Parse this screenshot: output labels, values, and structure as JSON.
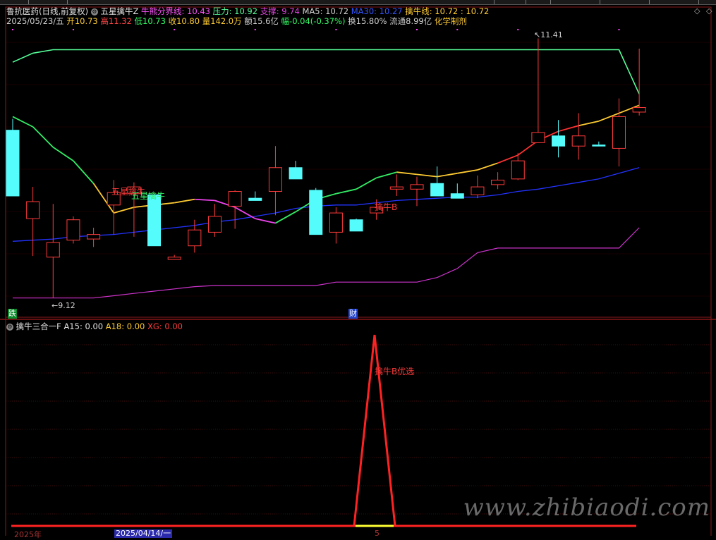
{
  "header": {
    "stock_name": "鲁抗医药(日线,前复权)",
    "indicator_name": "五星擒牛Z",
    "bull_line_label": "牛熊分界线: 10.43",
    "pressure_label": "压力: 10.92",
    "support_label": "支撑: 9.74",
    "ma5_label": "MA5: 10.72",
    "ma30_label": "MA30: 10.27",
    "qinniu_label": "擒牛线: 10.72 : 10.72",
    "date": "2025/05/23/五",
    "open": "开10.73",
    "high": "高11.32",
    "low": "低10.73",
    "close": "收10.80",
    "volume": "量142.0万",
    "amount": "额15.6亿",
    "change": "幅-0.04(-0.37%)",
    "turnover": "换15.80%",
    "float": "流通8.99亿",
    "sector": "化学制剂"
  },
  "sub_header": {
    "indicator_name": "擒牛三合一F",
    "a15": "A15: 0.00",
    "a18": "A18: 0.00",
    "xg": "XG: 0.00"
  },
  "annotations": {
    "high_marker": "11.41",
    "low_marker": "9.12",
    "signal_left_1": "五星擒牛",
    "signal_left_2": "五星擒牛",
    "signal_b": "擒牛B",
    "sub_signal": "擒牛B优选",
    "badge_die": "跌",
    "badge_cai": "财"
  },
  "footer": {
    "year": "2025年",
    "cursor_date": "2025/04/14/一",
    "month_mark": "5"
  },
  "watermark": "www.zhibiaodi.com",
  "colors": {
    "up": "#ff3b3b",
    "down": "#54fcfc",
    "ma5": "#ffcc33",
    "ma30": "#2233ff",
    "green_line": "#33ee66",
    "magenta_line": "#ee44ee",
    "pressure": "#55ff99",
    "support": "#cc33cc",
    "grid": "#8a1a1a"
  },
  "chart_data": {
    "type": "candlestick",
    "price_axis_visible": false,
    "candles": [
      {
        "o": 10.6,
        "h": 10.7,
        "l": 10.02,
        "c": 10.02,
        "dir": "down"
      },
      {
        "o": 9.82,
        "h": 10.1,
        "l": 9.49,
        "c": 9.97,
        "dir": "up"
      },
      {
        "o": 9.61,
        "h": 9.95,
        "l": 9.12,
        "c": 9.48,
        "dir": "up"
      },
      {
        "o": 9.63,
        "h": 9.84,
        "l": 9.6,
        "c": 9.81,
        "dir": "up"
      },
      {
        "o": 9.64,
        "h": 9.74,
        "l": 9.57,
        "c": 9.68,
        "dir": "up"
      },
      {
        "o": 9.94,
        "h": 10.16,
        "l": 9.68,
        "c": 10.05,
        "dir": "up"
      },
      {
        "o": 10.04,
        "h": 10.14,
        "l": 9.66,
        "c": 10.1,
        "dir": "up"
      },
      {
        "o": 10.03,
        "h": 10.04,
        "l": 9.58,
        "c": 9.58,
        "dir": "down"
      },
      {
        "o": 9.48,
        "h": 9.5,
        "l": 9.46,
        "c": 9.46,
        "dir": "up"
      },
      {
        "o": 9.72,
        "h": 9.81,
        "l": 9.52,
        "c": 9.58,
        "dir": "up"
      },
      {
        "o": 9.84,
        "h": 9.95,
        "l": 9.66,
        "c": 9.7,
        "dir": "up"
      },
      {
        "o": 9.93,
        "h": 10.07,
        "l": 9.73,
        "c": 10.06,
        "dir": "up"
      },
      {
        "o": 10.0,
        "h": 10.06,
        "l": 9.98,
        "c": 9.98,
        "dir": "down"
      },
      {
        "o": 10.27,
        "h": 10.46,
        "l": 9.85,
        "c": 10.06,
        "dir": "up"
      },
      {
        "o": 10.27,
        "h": 10.33,
        "l": 10.17,
        "c": 10.17,
        "dir": "down"
      },
      {
        "o": 10.07,
        "h": 10.09,
        "l": 9.68,
        "c": 9.68,
        "dir": "down"
      },
      {
        "o": 9.7,
        "h": 9.92,
        "l": 9.6,
        "c": 9.87,
        "dir": "up"
      },
      {
        "o": 9.81,
        "h": 9.82,
        "l": 9.71,
        "c": 9.71,
        "dir": "down"
      },
      {
        "o": 9.87,
        "h": 9.99,
        "l": 9.81,
        "c": 9.92,
        "dir": "up"
      },
      {
        "o": 10.1,
        "h": 10.21,
        "l": 10.02,
        "c": 10.08,
        "dir": "up"
      },
      {
        "o": 10.12,
        "h": 10.19,
        "l": 9.93,
        "c": 10.08,
        "dir": "up"
      },
      {
        "o": 10.13,
        "h": 10.28,
        "l": 10.02,
        "c": 10.02,
        "dir": "down"
      },
      {
        "o": 10.04,
        "h": 10.13,
        "l": 10.0,
        "c": 10.0,
        "dir": "down"
      },
      {
        "o": 10.1,
        "h": 10.2,
        "l": 10.0,
        "c": 10.03,
        "dir": "up"
      },
      {
        "o": 10.12,
        "h": 10.23,
        "l": 10.08,
        "c": 10.16,
        "dir": "up"
      },
      {
        "o": 10.17,
        "h": 10.4,
        "l": 10.16,
        "c": 10.33,
        "dir": "up"
      },
      {
        "o": 10.58,
        "h": 11.41,
        "l": 10.49,
        "c": 10.49,
        "dir": "up"
      },
      {
        "o": 10.55,
        "h": 10.69,
        "l": 10.36,
        "c": 10.46,
        "dir": "down"
      },
      {
        "o": 10.55,
        "h": 10.75,
        "l": 10.34,
        "c": 10.46,
        "dir": "up"
      },
      {
        "o": 10.47,
        "h": 10.5,
        "l": 10.46,
        "c": 10.46,
        "dir": "down"
      },
      {
        "o": 10.72,
        "h": 10.88,
        "l": 10.28,
        "c": 10.44,
        "dir": "up"
      },
      {
        "o": 10.76,
        "h": 11.32,
        "l": 10.73,
        "c": 10.8,
        "dir": "up"
      }
    ],
    "ma5": [
      10.6,
      10.6,
      10.25,
      9.88,
      9.72,
      9.72,
      9.79,
      9.81,
      9.81,
      9.78,
      9.76,
      9.7,
      9.73,
      9.82,
      9.99,
      10.13,
      10.07,
      9.99,
      9.96,
      10.02,
      10.1,
      10.09,
      10.09,
      10.1,
      10.23,
      10.33,
      10.45,
      10.51,
      10.56,
      10.6,
      10.66,
      10.72
    ],
    "ma30": [
      9.62,
      9.63,
      9.64,
      9.66,
      9.67,
      9.68,
      9.7,
      9.72,
      9.74,
      9.76,
      9.79,
      9.81,
      9.84,
      9.87,
      9.91,
      9.93,
      9.94,
      9.94,
      9.96,
      9.98,
      9.99,
      10.0,
      10.01,
      10.01,
      10.03,
      10.06,
      10.08,
      10.11,
      10.14,
      10.17,
      10.22,
      10.27
    ],
    "signal_line": [
      10.72,
      10.63,
      10.45,
      10.33,
      10.13,
      9.87,
      9.92,
      9.94,
      9.96,
      9.99,
      9.98,
      9.92,
      9.82,
      9.78,
      9.88,
      9.99,
      10.04,
      10.08,
      10.18,
      10.23,
      10.21,
      10.19,
      10.22,
      10.25,
      10.31,
      10.38,
      10.51,
      10.59,
      10.64,
      10.68,
      10.75,
      10.82
    ],
    "pressure_line": [
      11.2,
      11.28,
      11.31,
      11.31,
      11.31,
      11.31,
      11.31,
      11.31,
      11.31,
      11.31,
      11.31,
      11.31,
      11.31,
      11.31,
      11.31,
      11.31,
      11.31,
      11.31,
      11.31,
      11.31,
      11.31,
      11.31,
      11.31,
      11.31,
      11.31,
      11.31,
      11.31,
      11.31,
      11.31,
      11.31,
      11.31,
      10.92
    ],
    "support_line": [
      9.12,
      9.12,
      9.12,
      9.12,
      9.12,
      9.14,
      9.16,
      9.18,
      9.2,
      9.22,
      9.23,
      9.23,
      9.23,
      9.23,
      9.23,
      9.23,
      9.26,
      9.26,
      9.26,
      9.26,
      9.26,
      9.3,
      9.38,
      9.52,
      9.56,
      9.56,
      9.56,
      9.56,
      9.56,
      9.56,
      9.56,
      9.74
    ],
    "sub_indicator": {
      "type": "line",
      "values": [
        0,
        0,
        0,
        0,
        0,
        0,
        0,
        0,
        0,
        0,
        0,
        0,
        0,
        0,
        0,
        0,
        0,
        0,
        0,
        1,
        0,
        0,
        0,
        0,
        0,
        0,
        0,
        0,
        0,
        0,
        0,
        0
      ]
    }
  }
}
